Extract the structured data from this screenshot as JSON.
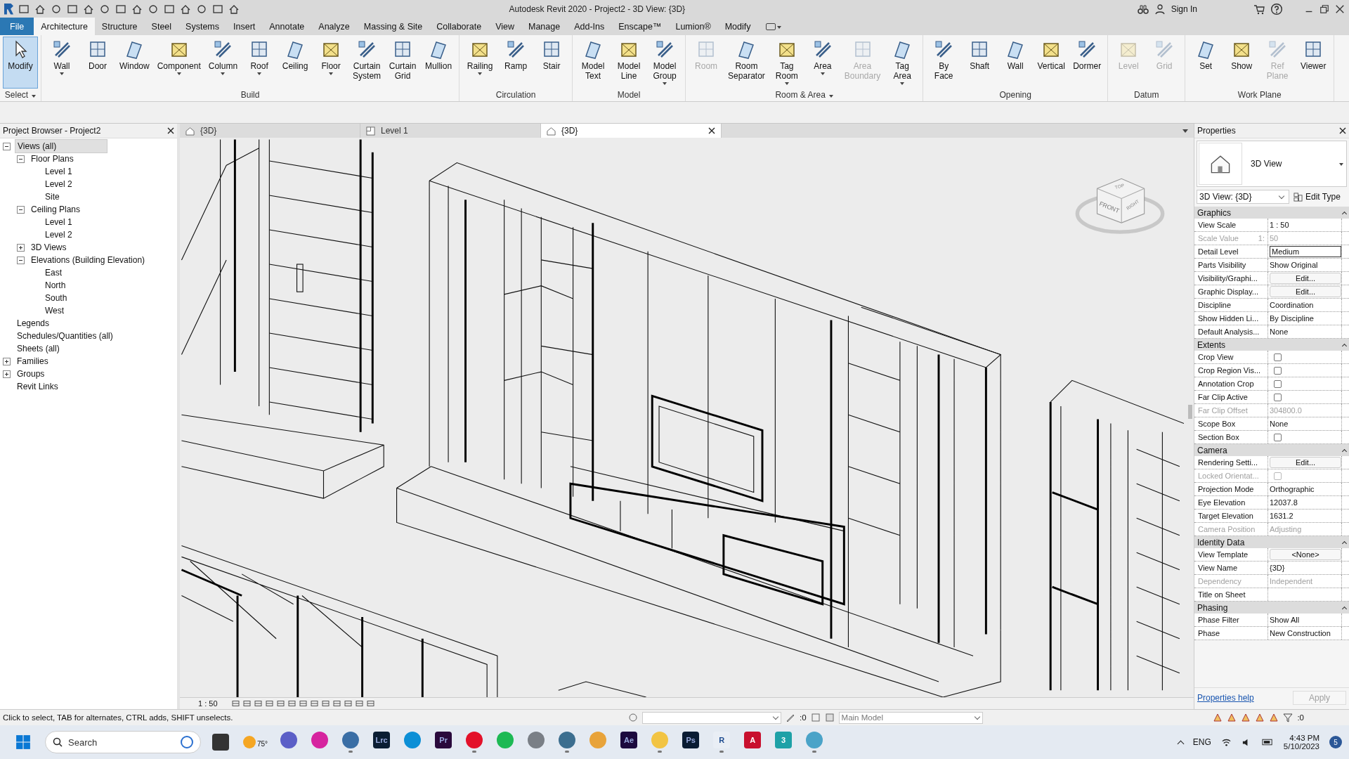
{
  "window": {
    "title": "Autodesk Revit 2020 - Project2 - 3D View: {3D}",
    "sign_in": "Sign In"
  },
  "ribbon_tabs": [
    {
      "label": "File",
      "kind": "file",
      "selected": false
    },
    {
      "label": "Architecture",
      "kind": "tab",
      "selected": true
    },
    {
      "label": "Structure",
      "kind": "tab",
      "selected": false
    },
    {
      "label": "Steel",
      "kind": "tab",
      "selected": false
    },
    {
      "label": "Systems",
      "kind": "tab",
      "selected": false
    },
    {
      "label": "Insert",
      "kind": "tab",
      "selected": false
    },
    {
      "label": "Annotate",
      "kind": "tab",
      "selected": false
    },
    {
      "label": "Analyze",
      "kind": "tab",
      "selected": false
    },
    {
      "label": "Massing & Site",
      "kind": "tab",
      "selected": false
    },
    {
      "label": "Collaborate",
      "kind": "tab",
      "selected": false
    },
    {
      "label": "View",
      "kind": "tab",
      "selected": false
    },
    {
      "label": "Manage",
      "kind": "tab",
      "selected": false
    },
    {
      "label": "Add-Ins",
      "kind": "tab",
      "selected": false
    },
    {
      "label": "Enscape™",
      "kind": "tab",
      "selected": false
    },
    {
      "label": "Lumion®",
      "kind": "tab",
      "selected": false
    },
    {
      "label": "Modify",
      "kind": "tab",
      "selected": false
    }
  ],
  "ribbon_panels": [
    {
      "title": "Select",
      "menu": true,
      "tools": [
        {
          "label": "Modify",
          "selected": true,
          "disabled": false,
          "dropdown": false
        }
      ]
    },
    {
      "title": "Build",
      "menu": false,
      "tools": [
        {
          "label": "Wall",
          "selected": false,
          "disabled": false,
          "dropdown": true
        },
        {
          "label": "Door",
          "selected": false,
          "disabled": false,
          "dropdown": false
        },
        {
          "label": "Window",
          "selected": false,
          "disabled": false,
          "dropdown": false
        },
        {
          "label": "Component",
          "selected": false,
          "disabled": false,
          "dropdown": true
        },
        {
          "label": "Column",
          "selected": false,
          "disabled": false,
          "dropdown": true
        },
        {
          "label": "Roof",
          "selected": false,
          "disabled": false,
          "dropdown": true
        },
        {
          "label": "Ceiling",
          "selected": false,
          "disabled": false,
          "dropdown": false
        },
        {
          "label": "Floor",
          "selected": false,
          "disabled": false,
          "dropdown": true
        },
        {
          "label": "Curtain\nSystem",
          "selected": false,
          "disabled": false,
          "dropdown": false
        },
        {
          "label": "Curtain\nGrid",
          "selected": false,
          "disabled": false,
          "dropdown": false
        },
        {
          "label": "Mullion",
          "selected": false,
          "disabled": false,
          "dropdown": false
        }
      ]
    },
    {
      "title": "Circulation",
      "menu": false,
      "tools": [
        {
          "label": "Railing",
          "selected": false,
          "disabled": false,
          "dropdown": true
        },
        {
          "label": "Ramp",
          "selected": false,
          "disabled": false,
          "dropdown": false
        },
        {
          "label": "Stair",
          "selected": false,
          "disabled": false,
          "dropdown": false
        }
      ]
    },
    {
      "title": "Model",
      "menu": false,
      "tools": [
        {
          "label": "Model\nText",
          "selected": false,
          "disabled": false,
          "dropdown": false
        },
        {
          "label": "Model\nLine",
          "selected": false,
          "disabled": false,
          "dropdown": false
        },
        {
          "label": "Model\nGroup",
          "selected": false,
          "disabled": false,
          "dropdown": true
        }
      ]
    },
    {
      "title": "Room & Area",
      "menu": true,
      "tools": [
        {
          "label": "Room",
          "selected": false,
          "disabled": true,
          "dropdown": false
        },
        {
          "label": "Room\nSeparator",
          "selected": false,
          "disabled": false,
          "dropdown": false
        },
        {
          "label": "Tag\nRoom",
          "selected": false,
          "disabled": false,
          "dropdown": true
        },
        {
          "label": "Area",
          "selected": false,
          "disabled": false,
          "dropdown": true
        },
        {
          "label": "Area\nBoundary",
          "selected": false,
          "disabled": true,
          "dropdown": false
        },
        {
          "label": "Tag\nArea",
          "selected": false,
          "disabled": false,
          "dropdown": true
        }
      ]
    },
    {
      "title": "Opening",
      "menu": false,
      "tools": [
        {
          "label": "By\nFace",
          "selected": false,
          "disabled": false,
          "dropdown": false
        },
        {
          "label": "Shaft",
          "selected": false,
          "disabled": false,
          "dropdown": false
        },
        {
          "label": "Wall",
          "selected": false,
          "disabled": false,
          "dropdown": false
        },
        {
          "label": "Vertical",
          "selected": false,
          "disabled": false,
          "dropdown": false
        },
        {
          "label": "Dormer",
          "selected": false,
          "disabled": false,
          "dropdown": false
        }
      ]
    },
    {
      "title": "Datum",
      "menu": false,
      "tools": [
        {
          "label": "Level",
          "selected": false,
          "disabled": true,
          "dropdown": false
        },
        {
          "label": "Grid",
          "selected": false,
          "disabled": true,
          "dropdown": false
        }
      ]
    },
    {
      "title": "Work Plane",
      "menu": false,
      "tools": [
        {
          "label": "Set",
          "selected": false,
          "disabled": false,
          "dropdown": false
        },
        {
          "label": "Show",
          "selected": false,
          "disabled": false,
          "dropdown": false
        },
        {
          "label": "Ref\nPlane",
          "selected": false,
          "disabled": true,
          "dropdown": false
        },
        {
          "label": "Viewer",
          "selected": false,
          "disabled": false,
          "dropdown": false
        }
      ]
    }
  ],
  "project_browser": {
    "title": "Project Browser - Project2",
    "tree": [
      {
        "label": "Views (all)",
        "selected": true,
        "expanded": true,
        "children": [
          {
            "label": "Floor Plans",
            "selected": false,
            "expanded": true,
            "children": [
              {
                "label": "Level 1",
                "selected": false
              },
              {
                "label": "Level 2",
                "selected": false
              },
              {
                "label": "Site",
                "selected": false
              }
            ]
          },
          {
            "label": "Ceiling Plans",
            "selected": false,
            "expanded": true,
            "children": [
              {
                "label": "Level 1",
                "selected": false
              },
              {
                "label": "Level 2",
                "selected": false
              }
            ]
          },
          {
            "label": "3D Views",
            "selected": false,
            "expanded": false
          },
          {
            "label": "Elevations (Building Elevation)",
            "selected": false,
            "expanded": true,
            "children": [
              {
                "label": "East",
                "selected": false
              },
              {
                "label": "North",
                "selected": false
              },
              {
                "label": "South",
                "selected": false
              },
              {
                "label": "West",
                "selected": false
              }
            ]
          }
        ]
      },
      {
        "label": "Legends",
        "selected": false
      },
      {
        "label": "Schedules/Quantities (all)",
        "selected": false
      },
      {
        "label": "Sheets (all)",
        "selected": false
      },
      {
        "label": "Families",
        "selected": false,
        "expanded": false
      },
      {
        "label": "Groups",
        "selected": false,
        "expanded": false
      },
      {
        "label": "Revit Links",
        "selected": false
      }
    ]
  },
  "view_tabs": [
    {
      "label": "{3D}",
      "kind": "model",
      "selected": false
    },
    {
      "label": "Level 1",
      "kind": "plan",
      "selected": false
    },
    {
      "label": "{3D}",
      "kind": "model",
      "selected": true
    }
  ],
  "view_cube": {
    "top": "TOP",
    "front": "FRONT",
    "right": "RIGHT"
  },
  "view_scale": "1 : 50",
  "properties": {
    "title": "Properties",
    "type_name": "3D View",
    "type_selector": "3D View: {3D}",
    "edit_type": "Edit Type",
    "groups": [
      {
        "name": "Graphics",
        "rows": [
          {
            "label": "View Scale",
            "kind": "text",
            "value": "1 : 50",
            "disabled": false
          },
          {
            "label": "Scale Value",
            "unit": "1:",
            "kind": "text",
            "value": "50",
            "disabled": true
          },
          {
            "label": "Detail Level",
            "kind": "field",
            "value": "Medium",
            "disabled": false
          },
          {
            "label": "Parts Visibility",
            "kind": "text",
            "value": "Show Original",
            "disabled": false
          },
          {
            "label": "Visibility/Graphi...",
            "kind": "button",
            "value": "Edit...",
            "disabled": false
          },
          {
            "label": "Graphic Display...",
            "kind": "button",
            "value": "Edit...",
            "disabled": false
          },
          {
            "label": "Discipline",
            "kind": "text",
            "value": "Coordination",
            "disabled": false
          },
          {
            "label": "Show Hidden Li...",
            "kind": "text",
            "value": "By Discipline",
            "disabled": false
          },
          {
            "label": "Default Analysis...",
            "kind": "text",
            "value": "None",
            "disabled": false
          }
        ]
      },
      {
        "name": "Extents",
        "rows": [
          {
            "label": "Crop View",
            "kind": "checkbox",
            "checked": false,
            "disabled": false
          },
          {
            "label": "Crop Region Vis...",
            "kind": "checkbox",
            "checked": false,
            "disabled": false
          },
          {
            "label": "Annotation Crop",
            "kind": "checkbox",
            "checked": false,
            "disabled": false
          },
          {
            "label": "Far Clip Active",
            "kind": "checkbox",
            "checked": false,
            "disabled": false
          },
          {
            "label": "Far Clip Offset",
            "kind": "text",
            "value": "304800.0",
            "disabled": true
          },
          {
            "label": "Scope Box",
            "kind": "text",
            "value": "None",
            "disabled": false
          },
          {
            "label": "Section Box",
            "kind": "checkbox",
            "checked": false,
            "disabled": false
          }
        ]
      },
      {
        "name": "Camera",
        "rows": [
          {
            "label": "Rendering Setti...",
            "kind": "button",
            "value": "Edit...",
            "disabled": false
          },
          {
            "label": "Locked Orientat...",
            "kind": "checkbox",
            "checked": false,
            "disabled": true
          },
          {
            "label": "Projection Mode",
            "kind": "text",
            "value": "Orthographic",
            "disabled": false
          },
          {
            "label": "Eye Elevation",
            "kind": "text",
            "value": "12037.8",
            "disabled": false
          },
          {
            "label": "Target Elevation",
            "kind": "text",
            "value": "1631.2",
            "disabled": false
          },
          {
            "label": "Camera Position",
            "kind": "text",
            "value": "Adjusting",
            "disabled": true
          }
        ]
      },
      {
        "name": "Identity Data",
        "rows": [
          {
            "label": "View Template",
            "kind": "button",
            "value": "<None>",
            "disabled": false
          },
          {
            "label": "View Name",
            "kind": "text",
            "value": "{3D}",
            "disabled": false
          },
          {
            "label": "Dependency",
            "kind": "text",
            "value": "Independent",
            "disabled": true
          },
          {
            "label": "Title on Sheet",
            "kind": "text",
            "disabled": false
          }
        ]
      },
      {
        "name": "Phasing",
        "rows": [
          {
            "label": "Phase Filter",
            "kind": "text",
            "value": "Show All",
            "disabled": false
          },
          {
            "label": "Phase",
            "kind": "text",
            "value": "New Construction",
            "disabled": false
          }
        ]
      }
    ],
    "help": "Properties help",
    "apply": "Apply"
  },
  "status_bar": {
    "message": "Click to select, TAB for alternates, CTRL adds, SHIFT unselects.",
    "workset_count": ":0",
    "model": "Main Model",
    "filter_count": ":0"
  },
  "taskbar": {
    "search": "Search",
    "weather": "75°",
    "apps": [
      {
        "kind": "plain",
        "color": "#5b5fc7",
        "running": false
      },
      {
        "kind": "plain",
        "color": "#d6249f",
        "running": false
      },
      {
        "kind": "plain",
        "color": "#3a6ea5",
        "running": true
      },
      {
        "kind": "letter",
        "label": "Lrc",
        "color": "#0b1e33",
        "running": false
      },
      {
        "kind": "plain",
        "color": "#0c8fd6",
        "running": false
      },
      {
        "kind": "letter",
        "label": "Pr",
        "color": "#2a0a3c",
        "running": false
      },
      {
        "kind": "plain",
        "color": "#e3112a",
        "running": true
      },
      {
        "kind": "plain",
        "color": "#1db954",
        "running": false
      },
      {
        "kind": "plain",
        "color": "#7a7f86",
        "running": false
      },
      {
        "kind": "plain",
        "color": "#3c6e8f",
        "running": true
      },
      {
        "kind": "plain",
        "color": "#e8a33a",
        "running": false
      },
      {
        "kind": "letter",
        "label": "Ae",
        "color": "#1c0a3e",
        "running": false
      },
      {
        "kind": "plain",
        "color": "#f2c443",
        "running": true
      },
      {
        "kind": "letter",
        "label": "Ps",
        "color": "#0a1c33",
        "running": false
      },
      {
        "kind": "letter",
        "label": "R",
        "color": "#e9eef5",
        "running": true
      },
      {
        "kind": "letter",
        "label": "A",
        "color": "#c8102e",
        "running": false
      },
      {
        "kind": "letter",
        "label": "3",
        "color": "#1ea1a7",
        "running": false
      },
      {
        "kind": "plain",
        "color": "#4aa3c8",
        "running": true
      }
    ],
    "language": "ENG",
    "time": "4:43 PM",
    "date": "5/10/2023",
    "badge": "5"
  }
}
